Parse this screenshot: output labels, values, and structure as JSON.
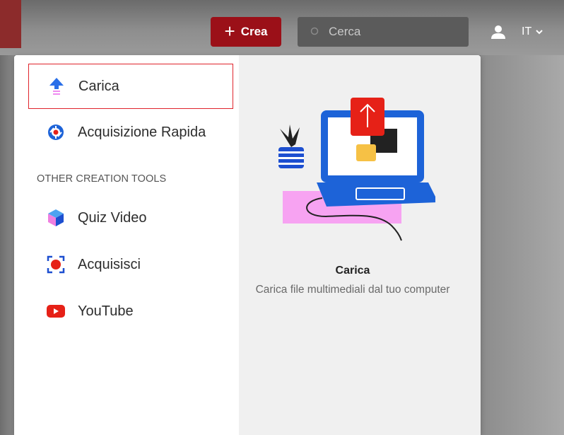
{
  "header": {
    "create_label": "Crea",
    "create_icon": "plus-icon",
    "search_placeholder": "Cerca",
    "language": "IT",
    "accent_color": "#9b1018"
  },
  "menu": {
    "items": [
      {
        "label": "Carica",
        "icon": "upload-arrow-icon",
        "selected": true
      },
      {
        "label": "Acquisizione Rapida",
        "icon": "quick-capture-icon"
      }
    ],
    "section_title": "OTHER CREATION TOOLS",
    "tools": [
      {
        "label": "Quiz Video",
        "icon": "cube-icon"
      },
      {
        "label": "Acquisisci",
        "icon": "record-icon"
      },
      {
        "label": "YouTube",
        "icon": "youtube-icon"
      }
    ]
  },
  "preview": {
    "title": "Carica",
    "description": "Carica file multimediali dal tuo computer",
    "illustration": "laptop-upload-illustration"
  }
}
